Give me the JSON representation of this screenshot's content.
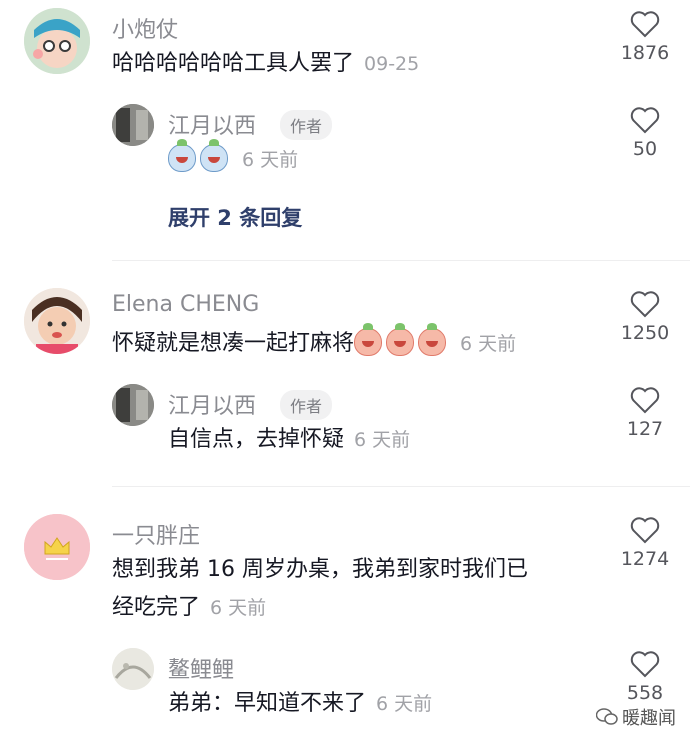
{
  "comments": [
    {
      "user": "小炮仗",
      "text": "哈哈哈哈哈哈工具人罢了",
      "time": "09-25",
      "likes": "1876",
      "reply": {
        "user": "江月以西",
        "badge": "作者",
        "text": "",
        "emoji_count": 2,
        "time": "6 天前",
        "likes": "50"
      },
      "expand_label": "展开 2 条回复"
    },
    {
      "user": "Elena CHENG",
      "text": "怀疑就是想凑一起打麻将",
      "emoji_count": 3,
      "time": "6 天前",
      "likes": "1250",
      "reply": {
        "user": "江月以西",
        "badge": "作者",
        "text": "自信点，去掉怀疑",
        "time": "6 天前",
        "likes": "127"
      }
    },
    {
      "user": "一只胖庄",
      "text_line1": "想到我弟 16 周岁办桌，我弟到家时我们已",
      "text_line2": "经吃完了",
      "time": "6 天前",
      "likes": "1274",
      "reply": {
        "user": "鳌鲤鲤",
        "text": "弟弟：早知道不来了",
        "time": "6 天前",
        "likes": "558"
      }
    }
  ],
  "watermark": "暖趣闻",
  "icons": [
    "heart-icon",
    "wechat-icon"
  ]
}
